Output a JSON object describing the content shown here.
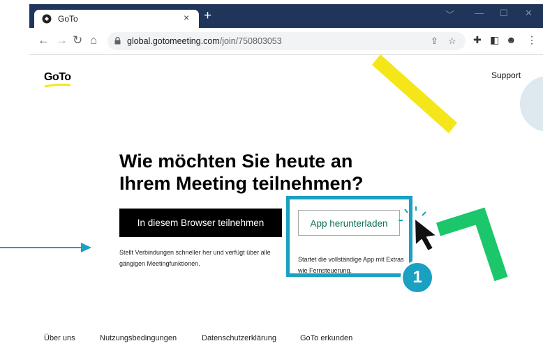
{
  "browser": {
    "tab_title": "GoTo",
    "tab_close": "×",
    "new_tab": "+",
    "url_host": "global.gotomeeting.com",
    "url_path": "/join/750803053",
    "window_controls": [
      "﹀",
      "—",
      "☐",
      "✕"
    ],
    "colors": {
      "frame": "#1f3559",
      "toolbar": "#ffffff"
    }
  },
  "page": {
    "logo": "GoTo",
    "support_link": "Support",
    "heading_line1": "Wie möchten Sie heute an",
    "heading_line2": "Ihrem Meeting teilnehmen?",
    "browser_button": "In diesem Browser teilnehmen",
    "browser_desc_line1": "Stellt Verbindungen schneller her und verfügt über alle",
    "browser_desc_line2": "gängigen Meetingfunktionen.",
    "app_button": "App herunterladen",
    "app_desc_line1": "Startet die vollständige App mit Extras",
    "app_desc_line2": "wie Fernsteuerung.",
    "footer": [
      "Über uns",
      "Nutzungsbedingungen",
      "Datenschutzerklärung",
      "GoTo erkunden"
    ]
  },
  "annotation": {
    "step_number": "1",
    "highlight_color": "#1aa0c1",
    "arrow_color": "#1aa0c1"
  },
  "decorations": {
    "yellow": "#f5e61a",
    "green": "#1bc76a",
    "circle": "#dde9ee"
  }
}
